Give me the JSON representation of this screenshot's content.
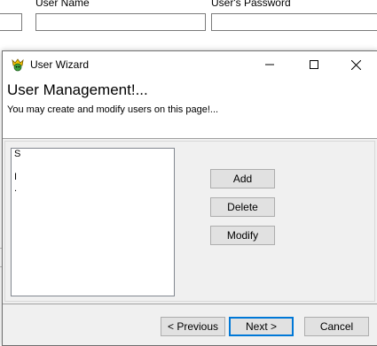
{
  "background_form": {
    "user_name_label": "User Name",
    "password_label": "User's Password"
  },
  "dialog": {
    "title": "User Wizard",
    "heading": "User Management!...",
    "subheading": "You may create and modify users on this page!...",
    "users_list": [
      "S",
      "",
      "I",
      "."
    ],
    "buttons": {
      "add": "Add",
      "delete": "Delete",
      "modify": "Modify",
      "previous": "< Previous",
      "next": "Next >",
      "cancel": "Cancel"
    }
  }
}
